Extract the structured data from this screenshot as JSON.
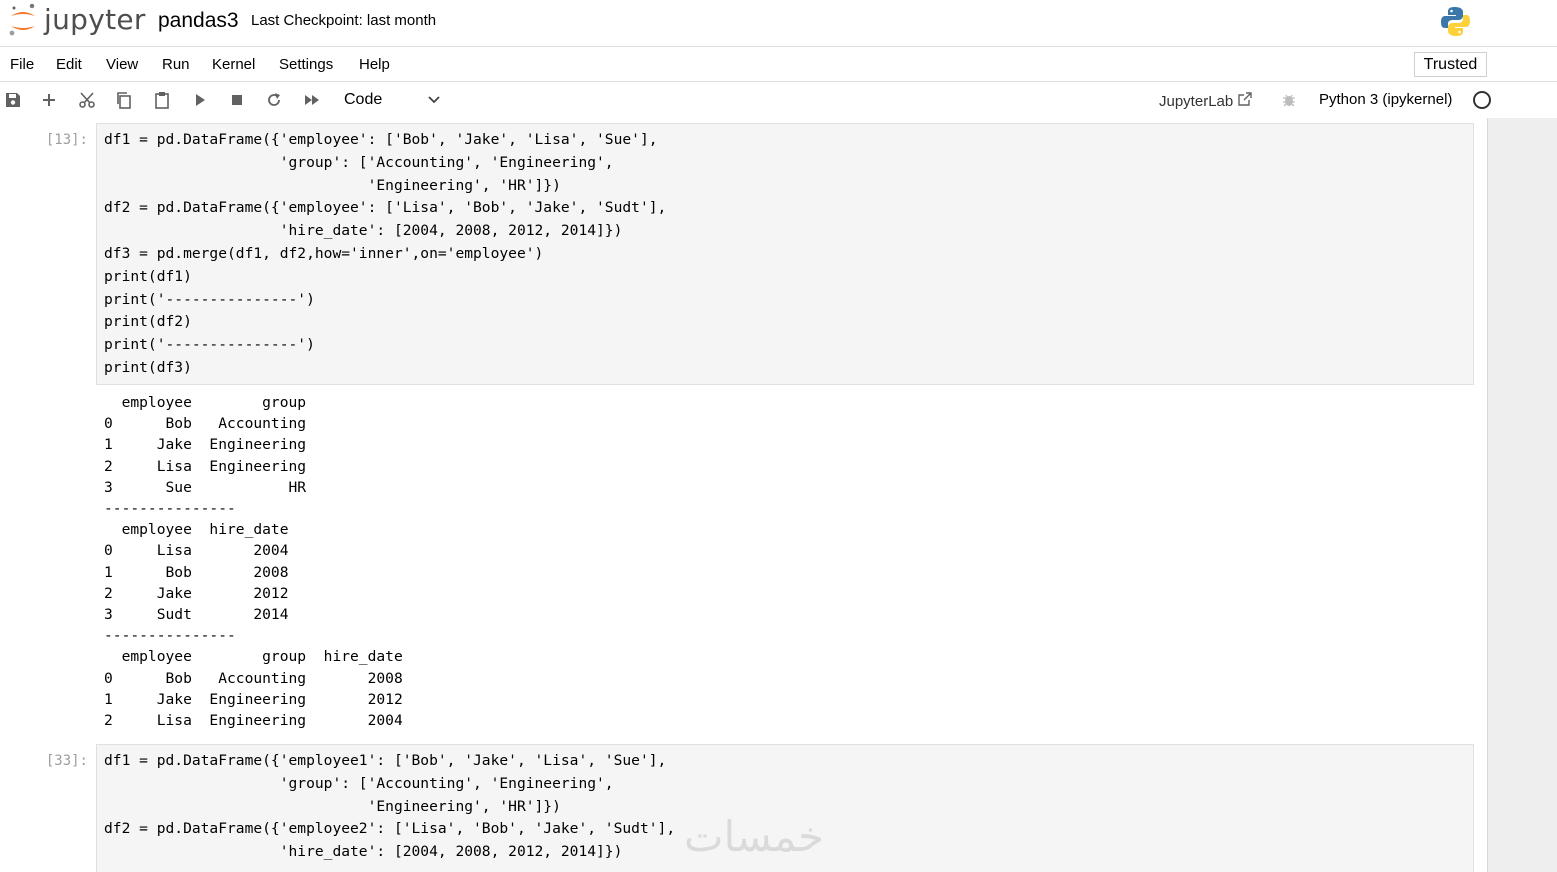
{
  "header": {
    "logo_text": "jupyter",
    "notebook_title": "pandas3",
    "checkpoint": "Last Checkpoint: last month"
  },
  "menu": {
    "items": [
      "File",
      "Edit",
      "View",
      "Run",
      "Kernel",
      "Settings",
      "Help"
    ],
    "trusted": "Trusted"
  },
  "toolbar": {
    "buttons": [
      "save-icon",
      "add-cell-icon",
      "cut-icon",
      "copy-icon",
      "paste-icon",
      "run-icon",
      "stop-icon",
      "restart-icon",
      "fast-forward-icon"
    ],
    "cell_type": "Code",
    "jupyterlab_label": "JupyterLab",
    "kernel_name": "Python 3 (ipykernel)"
  },
  "cells": [
    {
      "prompt": "[13]:",
      "code_lines": [
        "df1 = pd.DataFrame({'employee': ['Bob', 'Jake', 'Lisa', 'Sue'],",
        "                    'group': ['Accounting', 'Engineering',",
        "                              'Engineering', 'HR']})",
        "df2 = pd.DataFrame({'employee': ['Lisa', 'Bob', 'Jake', 'Sudt'],",
        "                    'hire_date': [2004, 2008, 2012, 2014]})",
        "df3 = pd.merge(df1, df2,how='inner',on='employee')",
        "print(df1)",
        "print('---------------')",
        "print(df2)",
        "print('---------------')",
        "print(df3)"
      ],
      "output_lines": [
        "  employee        group",
        "0      Bob   Accounting",
        "1     Jake  Engineering",
        "2     Lisa  Engineering",
        "3      Sue           HR",
        "---------------",
        "  employee  hire_date",
        "0     Lisa       2004",
        "1      Bob       2008",
        "2     Jake       2012",
        "3     Sudt       2014",
        "---------------",
        "  employee        group  hire_date",
        "0      Bob   Accounting       2008",
        "1     Jake  Engineering       2012",
        "2     Lisa  Engineering       2004"
      ]
    },
    {
      "prompt": "[33]:",
      "code_lines": [
        "df1 = pd.DataFrame({'employee1': ['Bob', 'Jake', 'Lisa', 'Sue'],",
        "                    'group': ['Accounting', 'Engineering',",
        "                              'Engineering', 'HR']})",
        "df2 = pd.DataFrame({'employee2': ['Lisa', 'Bob', 'Jake', 'Sudt'],",
        "                    'hire_date': [2004, 2008, 2012, 2014]})"
      ]
    }
  ],
  "watermark": "خمسات"
}
